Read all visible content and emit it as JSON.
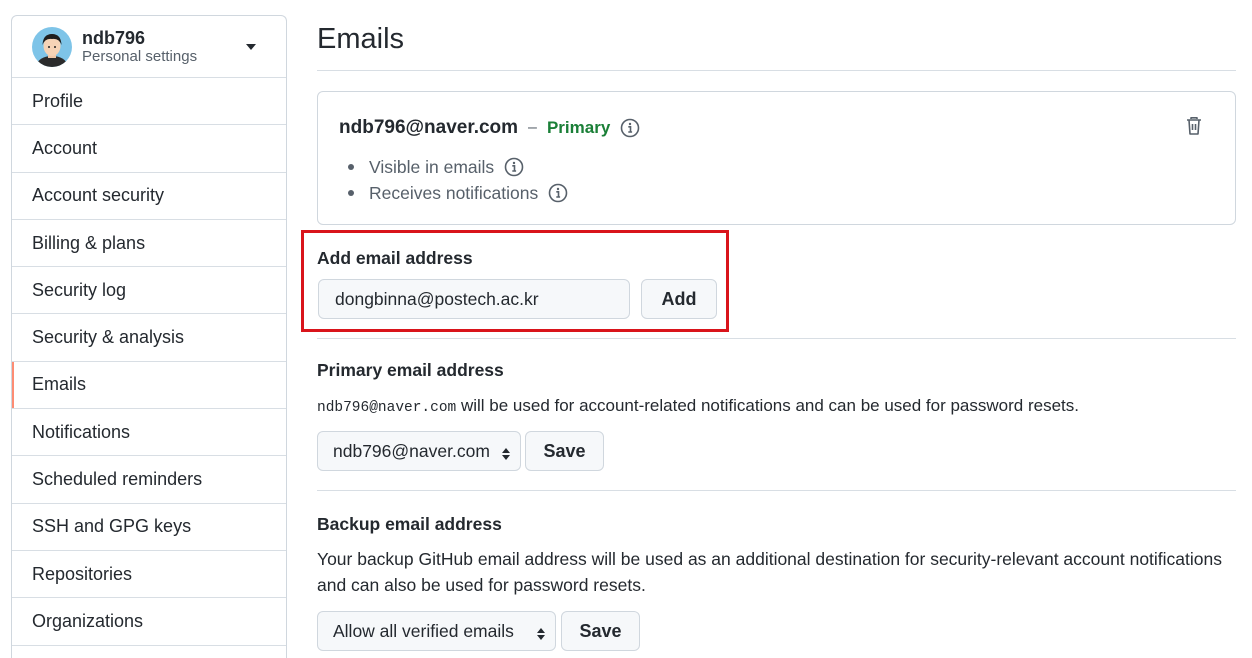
{
  "account": {
    "username": "ndb796",
    "subtitle": "Personal settings"
  },
  "sidebar": {
    "items": [
      {
        "label": "Profile"
      },
      {
        "label": "Account"
      },
      {
        "label": "Account security"
      },
      {
        "label": "Billing & plans"
      },
      {
        "label": "Security log"
      },
      {
        "label": "Security & analysis"
      },
      {
        "label": "Emails",
        "active": true
      },
      {
        "label": "Notifications"
      },
      {
        "label": "Scheduled reminders"
      },
      {
        "label": "SSH and GPG keys"
      },
      {
        "label": "Repositories"
      },
      {
        "label": "Organizations"
      }
    ]
  },
  "page": {
    "title": "Emails"
  },
  "email_entry": {
    "address": "ndb796@naver.com",
    "separator": "–",
    "badge": "Primary",
    "bullets": [
      "Visible in emails",
      "Receives notifications"
    ]
  },
  "add_email": {
    "label": "Add email address",
    "input_value": "dongbinna@postech.ac.kr",
    "button": "Add"
  },
  "primary_email": {
    "label": "Primary email address",
    "code": "ndb796@naver.com",
    "description": " will be used for account-related notifications and can be used for password resets.",
    "selected": "ndb796@naver.com",
    "save": "Save"
  },
  "backup_email": {
    "label": "Backup email address",
    "description": "Your backup GitHub email address will be used as an additional destination for security-relevant account notifications and can also be used for password resets.",
    "selected": "Allow all verified emails",
    "save": "Save"
  },
  "colors": {
    "primary_green": "#1a7f37",
    "highlight_red": "#d9141b",
    "active_nav": "#fd8c73"
  }
}
